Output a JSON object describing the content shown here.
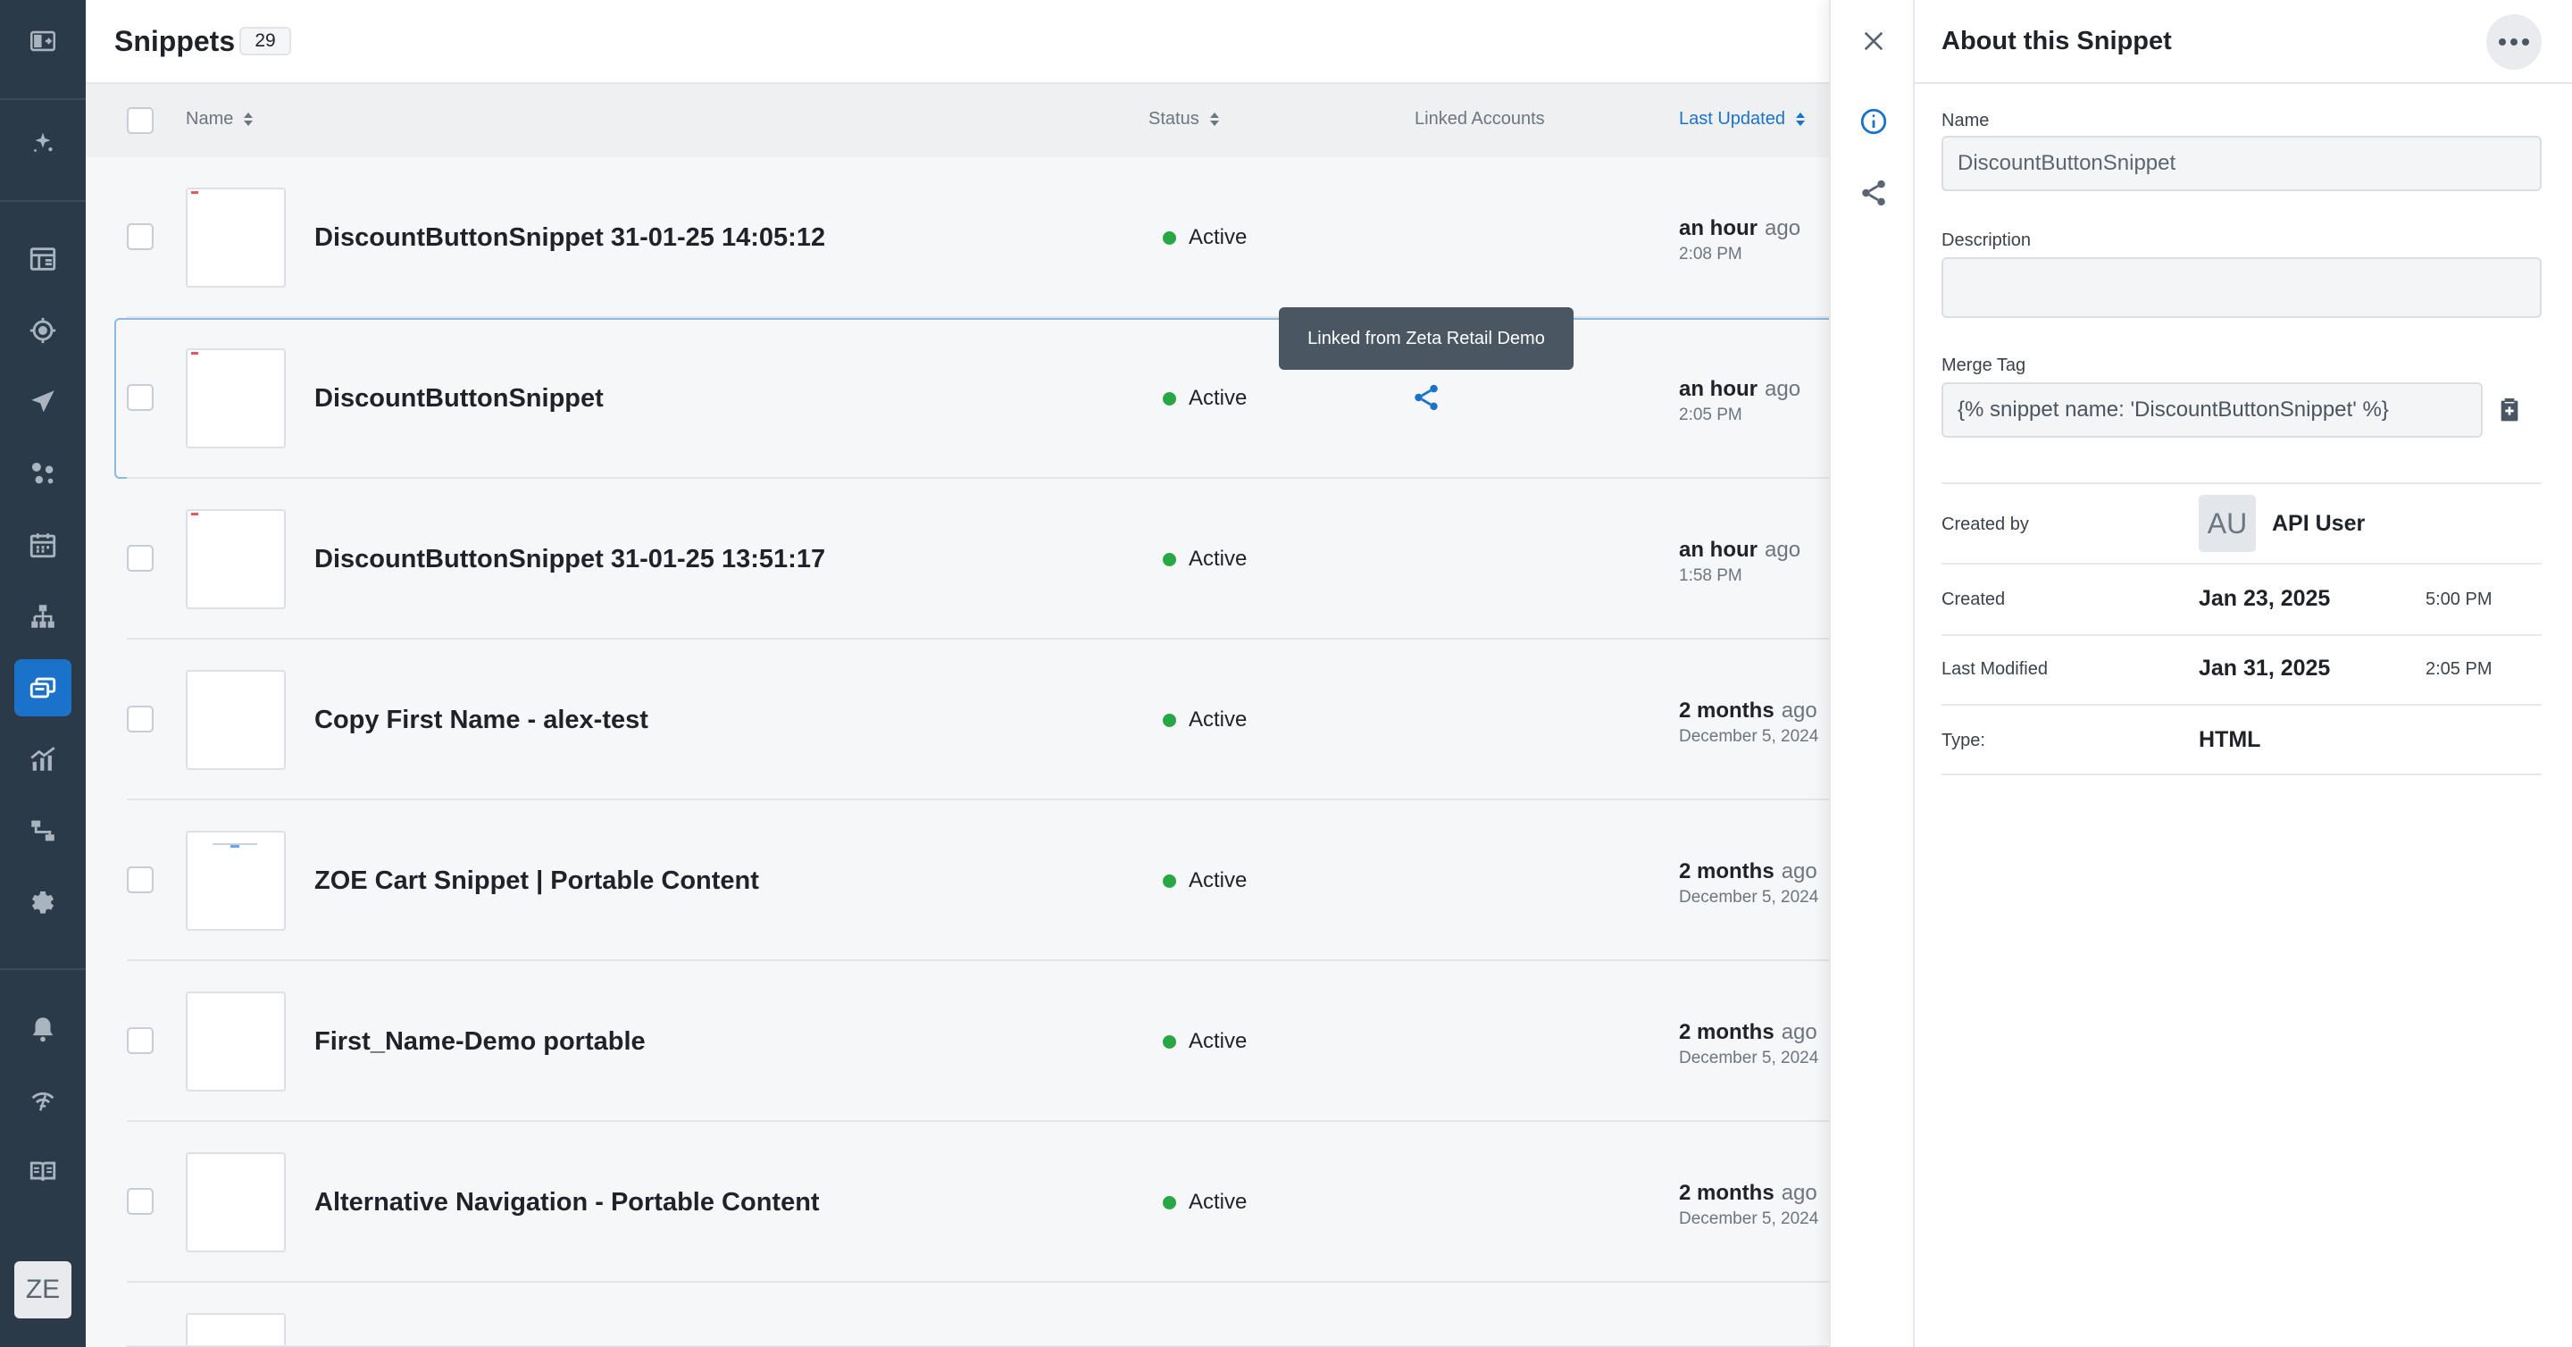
{
  "header": {
    "title": "Snippets",
    "count": "29"
  },
  "table": {
    "columns": {
      "name": "Name",
      "status": "Status",
      "linked": "Linked Accounts",
      "updated": "Last Updated"
    },
    "rows": [
      {
        "name": "DiscountButtonSnippet 31-01-25 14:05:12",
        "status": "Active",
        "rel": "an hour",
        "ago": "ago",
        "abs": "2:08 PM"
      },
      {
        "name": "DiscountButtonSnippet",
        "status": "Active",
        "rel": "an hour",
        "ago": "ago",
        "abs": "2:05 PM"
      },
      {
        "name": "DiscountButtonSnippet 31-01-25 13:51:17",
        "status": "Active",
        "rel": "an hour",
        "ago": "ago",
        "abs": "1:58 PM"
      },
      {
        "name": "Copy First Name - alex-test",
        "status": "Active",
        "rel": "2 months",
        "ago": "ago",
        "abs": "December 5, 2024"
      },
      {
        "name": "ZOE Cart Snippet | Portable Content",
        "status": "Active",
        "rel": "2 months",
        "ago": "ago",
        "abs": "December 5, 2024"
      },
      {
        "name": "First_Name-Demo portable",
        "status": "Active",
        "rel": "2 months",
        "ago": "ago",
        "abs": "December 5, 2024"
      },
      {
        "name": "Alternative Navigation - Portable Content",
        "status": "Active",
        "rel": "2 months",
        "ago": "ago",
        "abs": "December 5, 2024"
      }
    ]
  },
  "tooltip": "Linked from Zeta Retail Demo",
  "nav": {
    "avatar": "ZE"
  },
  "panel": {
    "title": "About this Snippet",
    "name_label": "Name",
    "name_value": "DiscountButtonSnippet",
    "description_label": "Description",
    "description_value": "",
    "merge_label": "Merge Tag",
    "merge_value": "{% snippet name: 'DiscountButtonSnippet' %}",
    "created_by_label": "Created by",
    "created_by_initials": "AU",
    "created_by_name": "API User",
    "created_label": "Created",
    "created_date": "Jan 23, 2025",
    "created_time": "5:00 PM",
    "modified_label": "Last Modified",
    "modified_date": "Jan 31, 2025",
    "modified_time": "2:05 PM",
    "type_label": "Type:",
    "type_value": "HTML"
  },
  "colors": {
    "nav_bg": "#2b3a48",
    "accent": "#1b72c9",
    "active_dot": "#29a745",
    "tooltip_bg": "#4a5661"
  }
}
